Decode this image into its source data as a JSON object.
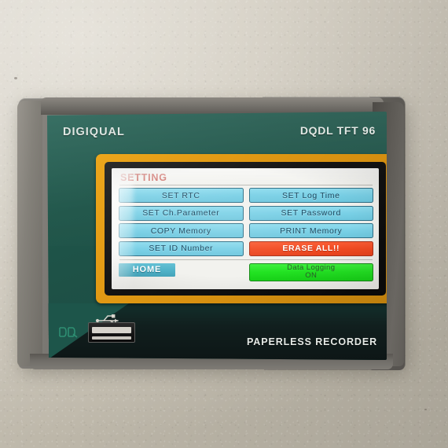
{
  "device": {
    "brand": "DIGIQUAL",
    "model": "DQDL TFT 96",
    "type_label": "PAPERLESS RECORDER",
    "logo_text": "DQ",
    "usb_icon": "usb-icon",
    "colors": {
      "faceplate_teal": "#1f5549",
      "frame_orange": "#e29a14",
      "bezel_gray": "#6e6b66",
      "wall_beige": "#d6d1c6"
    }
  },
  "screen": {
    "title": "SETTING",
    "title_color": "#c9625a",
    "background": "#f2f2ee",
    "buttons": [
      {
        "label": "SET RTC",
        "style": "normal"
      },
      {
        "label": "SET Log Time",
        "style": "normal"
      },
      {
        "label": "SET Ch.Parameter",
        "style": "normal"
      },
      {
        "label": "SET Password",
        "style": "normal"
      },
      {
        "label": "COPY Memory",
        "style": "normal"
      },
      {
        "label": "PRINT Memory",
        "style": "normal"
      },
      {
        "label": "SET ID Number",
        "style": "normal"
      },
      {
        "label": "ERASE ALL!!",
        "style": "danger"
      }
    ],
    "home_button": {
      "label": "HOME",
      "color": "#4fb2c8"
    },
    "logging_status": {
      "line1": "Data Logging",
      "line2": "ON",
      "state": "ON",
      "color": "#22e322"
    }
  }
}
